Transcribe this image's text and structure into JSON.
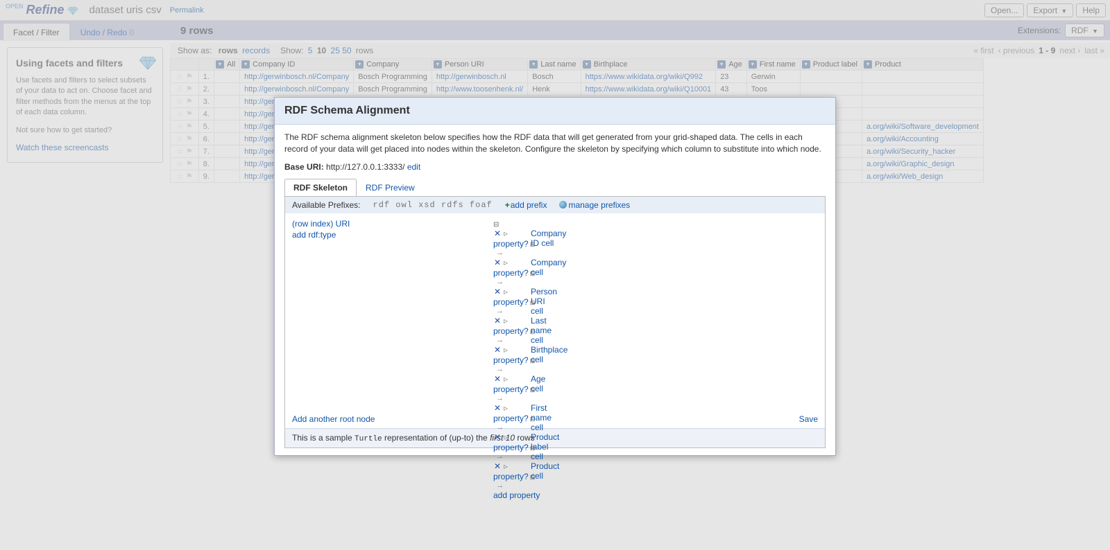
{
  "app": {
    "logo_open": "OPEN",
    "logo_main": "Refine",
    "project_name": "dataset uris csv",
    "permalink": "Permalink"
  },
  "topbuttons": {
    "open": "Open...",
    "export": "Export",
    "help": "Help"
  },
  "strip": {
    "tabs": {
      "facet": "Facet / Filter",
      "undo": "Undo / Redo",
      "undo_count": "0"
    },
    "rows_summary": "9 rows",
    "ext_label": "Extensions:",
    "ext_value": "RDF"
  },
  "facets": {
    "heading": "Using facets and filters",
    "p1": "Use facets and filters to select subsets of your data to act on. Choose facet and filter methods from the menus at the top of each data column.",
    "p2": "Not sure how to get started?",
    "link": "Watch these screencasts"
  },
  "viewctl": {
    "showas": "Show as:",
    "rows": "rows",
    "records": "records",
    "show": "Show:",
    "opts": [
      "5",
      "10",
      "25",
      "50"
    ],
    "opt_sel": "10",
    "suffix": "rows",
    "pager": {
      "first": "« first",
      "prev": "‹ previous",
      "range": "1 - 9",
      "next": "next ›",
      "last": "last »"
    }
  },
  "columns": [
    "All",
    "Company ID",
    "Company",
    "Person URI",
    "Last name",
    "Birthplace",
    "Age",
    "First name",
    "Product label",
    "Product"
  ],
  "rows": [
    {
      "n": "1.",
      "company_id": "http://gerwinbosch.nl/Company",
      "company": "Bosch Programming",
      "person_uri": "http://gerwinbosch.nl",
      "last_name": "Bosch",
      "birthplace": "https://www.wikidata.org/wiki/Q992",
      "age": "23",
      "first_name": "Gerwin",
      "product_label": "",
      "product": ""
    },
    {
      "n": "2.",
      "company_id": "http://gerwinbosch.nl/Company",
      "company": "Bosch Programming",
      "person_uri": "http://www.toosenhenk.nl/",
      "last_name": "Henk",
      "birthplace": "https://www.wikidata.org/wiki/Q10001",
      "age": "43",
      "first_name": "Toos",
      "product_label": "",
      "product": ""
    },
    {
      "n": "3.",
      "company_id": "http://gerwinbo",
      "company": "",
      "person_uri": "",
      "last_name": "",
      "birthplace": "",
      "age": "",
      "first_name": "",
      "product_label": "",
      "product": ""
    },
    {
      "n": "4.",
      "company_id": "http://gerwinbo",
      "company": "",
      "person_uri": "",
      "last_name": "",
      "birthplace": "",
      "age": "",
      "first_name": "",
      "product_label": "",
      "product": ""
    },
    {
      "n": "5.",
      "company_id": "http://gerwinbo",
      "company": "",
      "person_uri": "",
      "last_name": "",
      "birthplace": "",
      "age": "",
      "first_name": "",
      "product_label": "",
      "product": "a.org/wiki/Software_development"
    },
    {
      "n": "6.",
      "company_id": "http://gerwinbo",
      "company": "",
      "person_uri": "",
      "last_name": "",
      "birthplace": "",
      "age": "",
      "first_name": "",
      "product_label": "",
      "product": "a.org/wiki/Accounting"
    },
    {
      "n": "7.",
      "company_id": "http://gerwinbo",
      "company": "",
      "person_uri": "",
      "last_name": "",
      "birthplace": "",
      "age": "",
      "first_name": "",
      "product_label": "",
      "product": "a.org/wiki/Security_hacker"
    },
    {
      "n": "8.",
      "company_id": "http://gerwinbo",
      "company": "",
      "person_uri": "",
      "last_name": "",
      "birthplace": "",
      "age": "",
      "first_name": "",
      "product_label": "",
      "product": "a.org/wiki/Graphic_design"
    },
    {
      "n": "9.",
      "company_id": "http://gerwinbo",
      "company": "",
      "person_uri": "",
      "last_name": "",
      "birthplace": "",
      "age": "",
      "first_name": "",
      "product_label": "",
      "product": "a.org/wiki/Web_design"
    }
  ],
  "dialog": {
    "title": "RDF Schema Alignment",
    "intro": "The RDF schema alignment skeleton below specifies how the RDF data that will get generated from your grid-shaped data. The cells in each record of your data will get placed into nodes within the skeleton. Configure the skeleton by specifying which column to substitute into which node.",
    "base_label": "Base URI:",
    "base_value": "http://127.0.0.1:3333/",
    "base_edit": "edit",
    "tabs": {
      "skeleton": "RDF Skeleton",
      "preview": "RDF Preview"
    },
    "prefixes": {
      "label": "Available Prefixes:",
      "list": "rdf  owl  xsd  rdfs  foaf",
      "add": "add prefix",
      "manage": "manage prefixes"
    },
    "root": {
      "row_index_uri": "(row index) URI",
      "add_type": "add rdf:type"
    },
    "property_label": "property?",
    "props": [
      "Company ID cell",
      "Company cell",
      "Person URI cell",
      "Last name cell",
      "Birthplace cell",
      "Age cell",
      "First name cell",
      "Product label cell",
      "Product cell"
    ],
    "add_property": "add property",
    "add_root": "Add another root node",
    "save": "Save",
    "sample_prefix": "This is a sample ",
    "sample_code": "Turtle",
    "sample_mid": " representation of (up-to) the ",
    "sample_em": "first 10",
    "sample_suffix": " rows"
  }
}
